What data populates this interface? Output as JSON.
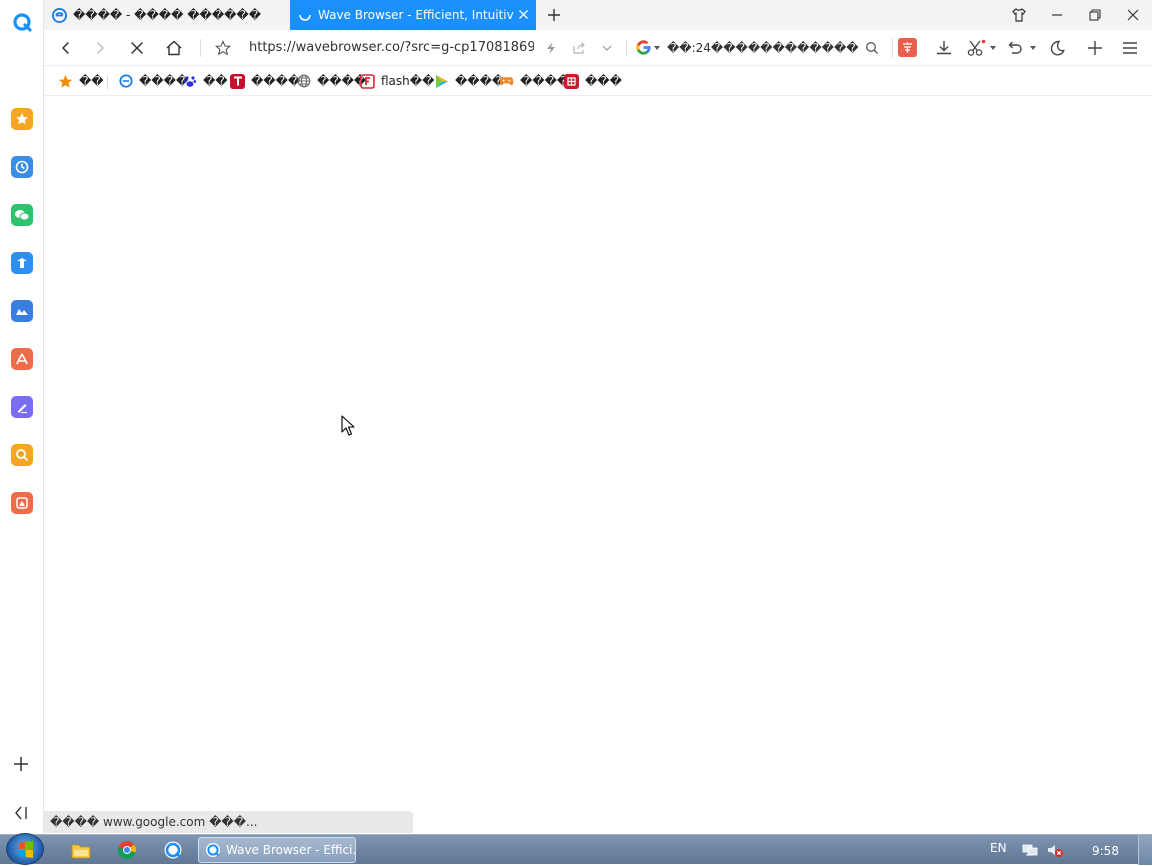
{
  "browser": {
    "accent": "#1a90ff"
  },
  "tabs": [
    {
      "title": "���� - ���� ������",
      "icon": "ie-icon",
      "active": false
    },
    {
      "title": "Wave Browser - Efficient, Intuitive an",
      "icon": "loading-spinner-icon",
      "active": true
    }
  ],
  "toolbar": {
    "url": "https://wavebrowser.co/?src=g-cp17081869",
    "search_engine_icon": "google-icon",
    "search_text": "��:24������������"
  },
  "bookmarks": [
    {
      "label": "��",
      "icon": "star-icon"
    },
    {
      "label": "����",
      "icon": "ie-icon"
    },
    {
      "label": "��",
      "icon": "baidu-paw-icon"
    },
    {
      "label": "����",
      "icon": "tmall-icon"
    },
    {
      "label": "����",
      "icon": "globe-icon"
    },
    {
      "label": "flash��",
      "icon": "flash-center-icon"
    },
    {
      "label": "����",
      "icon": "video-play-icon"
    },
    {
      "label": "����",
      "icon": "game-controller-icon"
    },
    {
      "label": "���",
      "icon": "taobao-icon"
    }
  ],
  "sidebar": {
    "apps": [
      {
        "name": "favorites-app",
        "color": "#f5a623"
      },
      {
        "name": "history-app",
        "color": "#3a8ee6"
      },
      {
        "name": "wechat-app",
        "color": "#2dc26b"
      },
      {
        "name": "transfer-app",
        "color": "#2f8ff0"
      },
      {
        "name": "cloud-app",
        "color": "#3a7fe0"
      },
      {
        "name": "pdf-app",
        "color": "#ef6c4a"
      },
      {
        "name": "notes-app",
        "color": "#7b6cf6"
      },
      {
        "name": "search-app",
        "color": "#f5a623"
      },
      {
        "name": "image-app",
        "color": "#ef6c4a"
      }
    ]
  },
  "statusbar": {
    "text": "���� www.google.com ���..."
  },
  "taskbar": {
    "active_window": "Wave Browser - Effici...",
    "language": "EN",
    "time": "9:58"
  }
}
